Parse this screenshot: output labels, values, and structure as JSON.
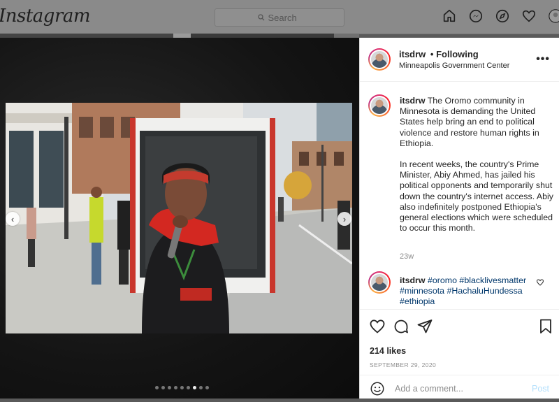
{
  "app": {
    "logo": "Instagram"
  },
  "search": {
    "placeholder": "Search"
  },
  "nav": {
    "icons": [
      "home-icon",
      "messenger-icon",
      "explore-icon",
      "heart-icon",
      "profile-avatar"
    ]
  },
  "post": {
    "header": {
      "username": "itsdrw",
      "follow_status": "• Following",
      "location": "Minneapolis Government Center",
      "more": "•••"
    },
    "caption": {
      "username": "itsdrw",
      "paragraph1": "The Oromo community in Minnesota is demanding the United States help bring an end to political violence and restore human rights in Ethiopia.",
      "paragraph2": "In recent weeks, the country's Prime Minister, Abiy Ahmed, has jailed his political opponents and temporarily shut down the country's internet access. Abiy also indefinitely postponed Ethiopia's general elections which were scheduled to occur this month.",
      "time": "23w"
    },
    "comment": {
      "username": "itsdrw",
      "tags": [
        "#oromo",
        "#blacklivesmatter",
        "#minnesota",
        "#HachaluHundessa",
        "#ethiopia"
      ]
    },
    "likes": "214 likes",
    "date": "SEPTEMBER 29, 2020",
    "add_comment_placeholder": "Add a comment...",
    "post_label": "Post",
    "carousel": {
      "total": 9,
      "active_index": 6,
      "prev": "‹",
      "next": "›"
    }
  },
  "colors": {
    "link": "#00376b",
    "post_disabled": "#b2dffc",
    "muted": "#8e8e8e",
    "text": "#262626"
  }
}
